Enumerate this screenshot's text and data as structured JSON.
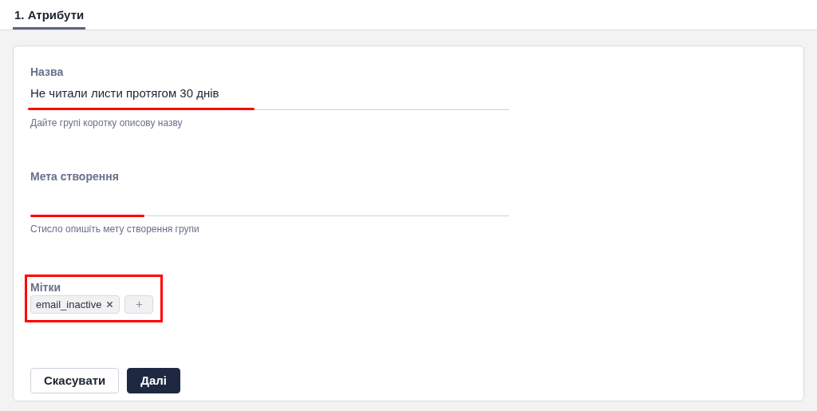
{
  "tabs": [
    {
      "label": "1. Атрибути",
      "selected": true
    }
  ],
  "form": {
    "fields": [
      {
        "label": "Назва",
        "value": "Не читали листи протягом 30 днів",
        "help": "Дайте групі коротку описову назву"
      },
      {
        "label": "Мета створення",
        "help": "Стисло опишіть мету створення групи"
      }
    ],
    "tags": {
      "label": "Мітки",
      "items": [
        "email_inactive"
      ]
    },
    "buttons": [
      {
        "label": "Скасувати",
        "kind": "secondary"
      },
      {
        "label": "Далі",
        "kind": "primary"
      }
    ]
  }
}
